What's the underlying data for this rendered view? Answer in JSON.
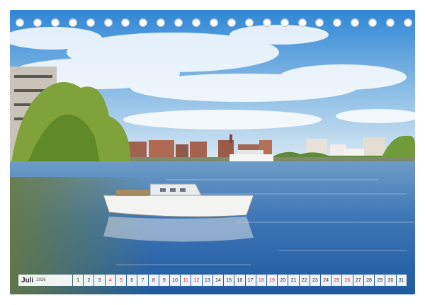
{
  "calendar": {
    "month": "Juli",
    "year": "2026",
    "days": [
      {
        "n": "1",
        "weekend": false
      },
      {
        "n": "2",
        "weekend": false
      },
      {
        "n": "3",
        "weekend": false
      },
      {
        "n": "4",
        "weekend": true
      },
      {
        "n": "5",
        "weekend": true
      },
      {
        "n": "6",
        "weekend": false
      },
      {
        "n": "7",
        "weekend": false
      },
      {
        "n": "8",
        "weekend": false
      },
      {
        "n": "9",
        "weekend": false
      },
      {
        "n": "10",
        "weekend": false
      },
      {
        "n": "11",
        "weekend": true
      },
      {
        "n": "12",
        "weekend": true
      },
      {
        "n": "13",
        "weekend": false
      },
      {
        "n": "14",
        "weekend": false
      },
      {
        "n": "15",
        "weekend": false
      },
      {
        "n": "16",
        "weekend": false
      },
      {
        "n": "17",
        "weekend": false
      },
      {
        "n": "18",
        "weekend": true
      },
      {
        "n": "19",
        "weekend": true
      },
      {
        "n": "20",
        "weekend": false
      },
      {
        "n": "21",
        "weekend": false
      },
      {
        "n": "22",
        "weekend": false
      },
      {
        "n": "23",
        "weekend": false
      },
      {
        "n": "24",
        "weekend": false
      },
      {
        "n": "25",
        "weekend": true
      },
      {
        "n": "26",
        "weekend": true
      },
      {
        "n": "27",
        "weekend": false
      },
      {
        "n": "28",
        "weekend": false
      },
      {
        "n": "29",
        "weekend": false
      },
      {
        "n": "30",
        "weekend": false
      },
      {
        "n": "31",
        "weekend": false
      }
    ],
    "weekend_color": "#d23a3a",
    "binding_hole_count": 23
  },
  "photo": {
    "sky_color": "#3d8fd9",
    "water_color": "#2f6fb3",
    "foliage_color": "#7fa33a"
  }
}
